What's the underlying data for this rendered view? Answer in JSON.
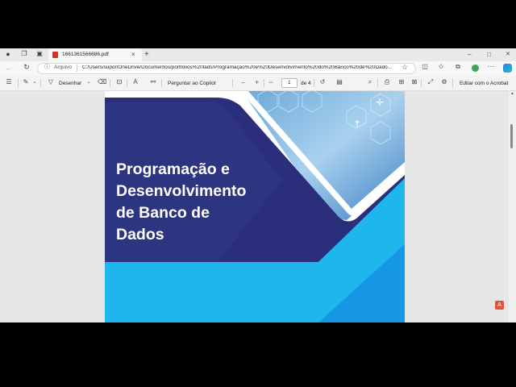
{
  "browser": {
    "tab_title": "1661361566686.pdf",
    "tab_close": "×",
    "new_tab": "+",
    "url_scheme": "Arquivo",
    "url": "C:/Users/supor/OneDrive/Documentos/portfólios%20tads/Programação%20e%20Desenvolvimento%20do%20Banco%20de%20Dado...",
    "win_min": "–",
    "win_max": "□",
    "win_close": "✕"
  },
  "pdf_toolbar": {
    "draw_label": "Desenhar",
    "copilot_label": "Perguntar ao Copilot",
    "zoom_out": "−",
    "zoom_in": "+",
    "page_current": "1",
    "page_total": "de 4",
    "acrobat_label": "Editar com o Acrobat"
  },
  "document": {
    "title_lines": [
      "Programação e",
      "Desenvolvimento",
      "de Banco de",
      "Dados"
    ]
  },
  "colors": {
    "navy": "#2b2e7a",
    "mid_blue": "#3a63a8",
    "cyan": "#1fb6ee",
    "bright_blue": "#1597e5",
    "acrobat_red": "#e0533c"
  }
}
